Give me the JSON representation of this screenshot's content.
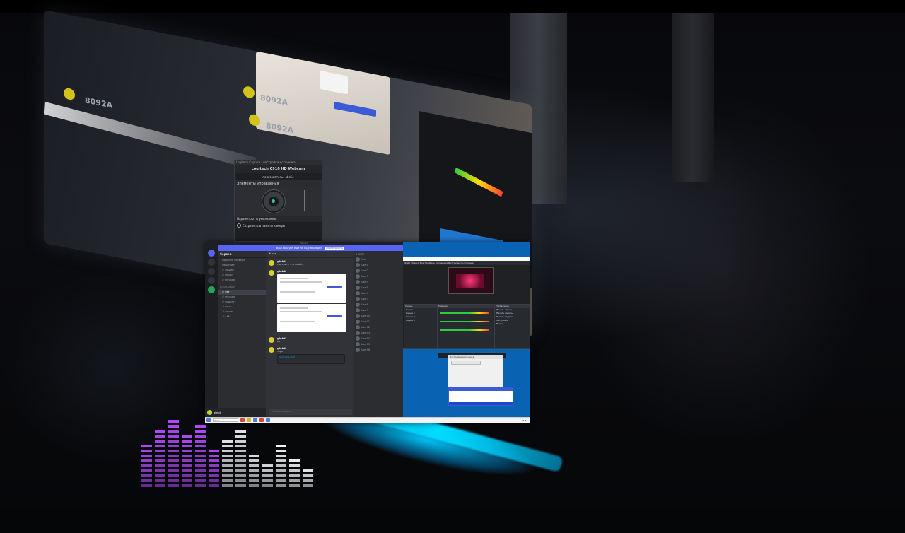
{
  "background": {
    "monitor_labels": [
      "8092A",
      "8092A",
      "8092A"
    ]
  },
  "webcam_dialog": {
    "title_bar": "Logitech Capture - настройки источника",
    "device_name": "Logitech C910 HD Webcam",
    "user_label": "пользователь",
    "user_name": "obs64",
    "controls_title": "Элементы управления",
    "footer_text": "Параметры по умолчанию",
    "checkbox_label": "Сохранить в памяти камеры"
  },
  "discord": {
    "title": "Discord",
    "notice": "Ваш аккаунт ещё не подтверждён",
    "notice_button": "Подтвердить",
    "guild_name": "Сервер",
    "channels": [
      "Правила сервера",
      "Общение",
      "# общий",
      "# мемы",
      "# музыка"
    ],
    "voice_category": "Голосовые",
    "voice_channels": [
      "# чат",
      "# музыка",
      "# подкаст",
      "# игры",
      "# стрим",
      "# AFK"
    ],
    "topbar": "# чат",
    "messages": [
      {
        "author": "gleb4",
        "text": "смотрите что нашёл"
      },
      {
        "author": "gleb4",
        "text": ""
      },
      {
        "author": "gleb4",
        "text": "вот"
      },
      {
        "author": "gleb4",
        "text": "звук"
      }
    ],
    "audio_label": "recording.mp3",
    "composer_placeholder": "Написать в #чат",
    "user_panel_name": "gleb4",
    "members_category_online": "В сети",
    "members": [
      "Mod",
      "User1",
      "User2",
      "User3",
      "User4",
      "User5",
      "User6",
      "User7",
      "User8",
      "User9",
      "User10",
      "User11",
      "User12",
      "User13",
      "User14",
      "User15",
      "User16"
    ]
  },
  "obs": {
    "menu": "Файл  Правка  Вид  Профиль  Коллекция  Инструменты  Справка",
    "dock_scenes": "Сцены",
    "dock_sources": "Источники",
    "dock_mixer": "Микшер",
    "dock_controls": "Управление",
    "scene_items": [
      "Сцена 1",
      "Сцена 2",
      "Сцена 3",
      "Сцена 4"
    ],
    "control_items": [
      "Начать стрим",
      "Начать запись",
      "Режим студии",
      "Настройки",
      "Выход"
    ],
    "settings_title": "Настройки источника"
  },
  "taskbar": {
    "search_placeholder": "Поиск",
    "clock": "21:34"
  }
}
